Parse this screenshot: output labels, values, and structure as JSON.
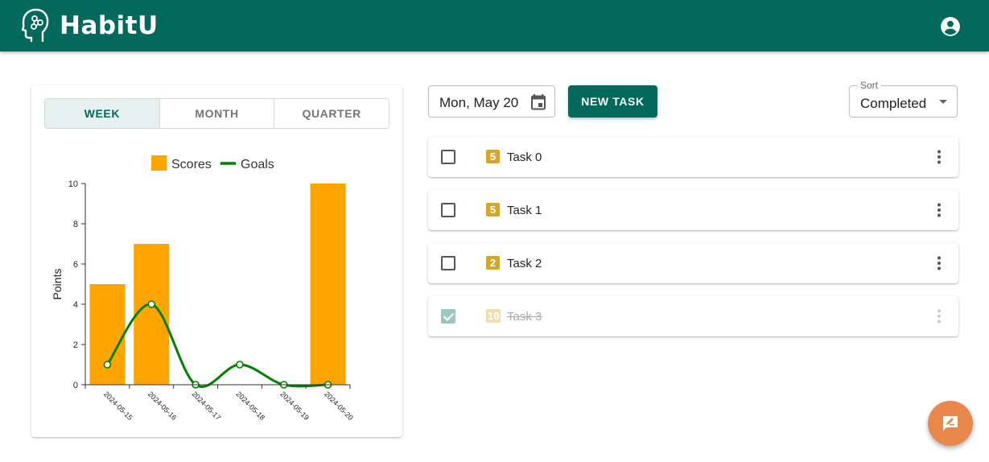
{
  "app": {
    "title": "HabitU"
  },
  "icons": {
    "logo": "brain-head-icon",
    "account": "account-circle-icon",
    "calendar": "calendar-icon",
    "more": "more-vert-icon",
    "fab": "feedback-icon"
  },
  "colors": {
    "primary": "#00695c",
    "scores": "#ffa500",
    "goals": "#008000",
    "points_badge": "#d4a72c",
    "fab": "#e8884a"
  },
  "period_toggle": {
    "options": [
      "WEEK",
      "MONTH",
      "QUARTER"
    ],
    "selected": "WEEK"
  },
  "chart_data": {
    "type": "bar",
    "categories": [
      "2024-05-15",
      "2024-05-16",
      "2024-05-17",
      "2024-05-18",
      "2024-05-19",
      "2024-05-20"
    ],
    "series": [
      {
        "name": "Scores",
        "type": "bar",
        "values": [
          5,
          7,
          0,
          0,
          0,
          10
        ]
      },
      {
        "name": "Goals",
        "type": "line",
        "values": [
          1,
          4,
          0,
          1,
          0,
          0
        ]
      }
    ],
    "ylabel": "Points",
    "xlabel": "",
    "ylim": [
      0,
      10
    ],
    "yticks": [
      0,
      2,
      4,
      6,
      8,
      10
    ],
    "legend": "top"
  },
  "toolbar": {
    "date_value": "Mon, May 20",
    "new_task_label": "NEW TASK",
    "sort_label": "Sort",
    "sort_value": "Completed"
  },
  "tasks": [
    {
      "name": "Task 0",
      "points": "5",
      "completed": false
    },
    {
      "name": "Task 1",
      "points": "5",
      "completed": false
    },
    {
      "name": "Task 2",
      "points": "2",
      "completed": false
    },
    {
      "name": "Task 3",
      "points": "10",
      "completed": true
    }
  ]
}
